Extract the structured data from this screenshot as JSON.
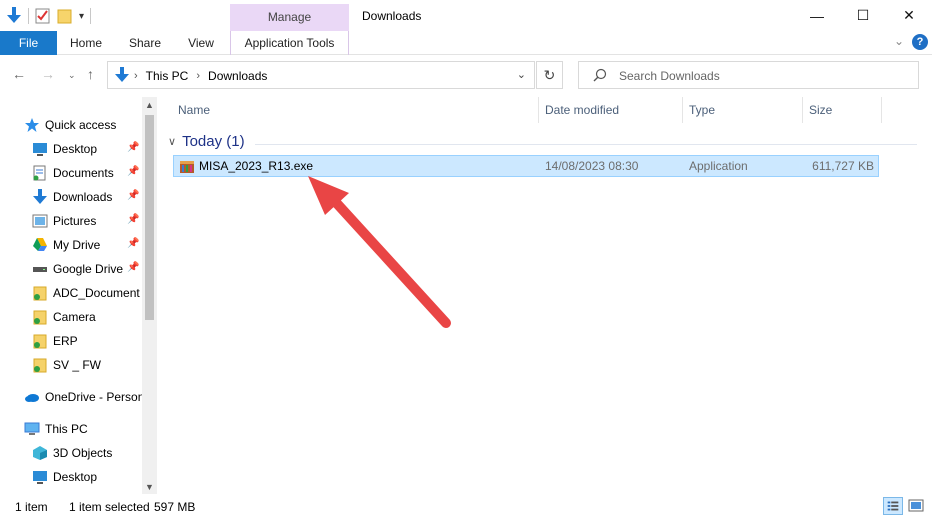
{
  "titlebar": {
    "manage_label": "Manage",
    "title": "Downloads",
    "minimize": "—",
    "maximize": "☐",
    "close": "✕"
  },
  "ribbon": {
    "tabs": [
      {
        "label": "File"
      },
      {
        "label": "Home"
      },
      {
        "label": "Share"
      },
      {
        "label": "View"
      },
      {
        "label": "Application Tools"
      }
    ],
    "help": "?"
  },
  "address": {
    "crumbs": [
      "This PC",
      "Downloads"
    ],
    "search_placeholder": "Search Downloads"
  },
  "navpane": {
    "items": [
      {
        "label": "Quick access",
        "icon": "star-icon",
        "pinned": false
      },
      {
        "label": "Desktop",
        "icon": "desktop-icon",
        "pinned": true
      },
      {
        "label": "Documents",
        "icon": "documents-icon",
        "pinned": true
      },
      {
        "label": "Downloads",
        "icon": "download-arrow-icon",
        "pinned": true
      },
      {
        "label": "Pictures",
        "icon": "pictures-icon",
        "pinned": true
      },
      {
        "label": "My Drive",
        "icon": "google-drive-icon",
        "pinned": true
      },
      {
        "label": "Google Drive",
        "icon": "drive-disk-icon",
        "pinned": true
      },
      {
        "label": "ADC_Document",
        "icon": "folder-icon",
        "pinned": false
      },
      {
        "label": "Camera",
        "icon": "folder-icon",
        "pinned": false
      },
      {
        "label": "ERP",
        "icon": "folder-icon",
        "pinned": false
      },
      {
        "label": "SV _ FW",
        "icon": "folder-icon",
        "pinned": false
      },
      {
        "label": "OneDrive - Person",
        "icon": "onedrive-icon",
        "pinned": false
      },
      {
        "label": "This PC",
        "icon": "computer-icon",
        "pinned": false
      },
      {
        "label": "3D Objects",
        "icon": "3d-objects-icon",
        "pinned": false
      },
      {
        "label": "Desktop",
        "icon": "desktop-icon",
        "pinned": false
      }
    ]
  },
  "columns": {
    "name": "Name",
    "date": "Date modified",
    "type": "Type",
    "size": "Size"
  },
  "group": {
    "label": "Today (1)"
  },
  "files": [
    {
      "name": "MISA_2023_R13.exe",
      "date": "14/08/2023 08:30",
      "type": "Application",
      "size": "611,727 KB"
    }
  ],
  "status": {
    "count": "1 item",
    "selected": "1 item selected",
    "size": "597 MB"
  },
  "colors": {
    "accent": "#1979ca",
    "selection": "#cce8ff",
    "manage_tab": "#ead8f6",
    "arrow": "#e94545"
  }
}
